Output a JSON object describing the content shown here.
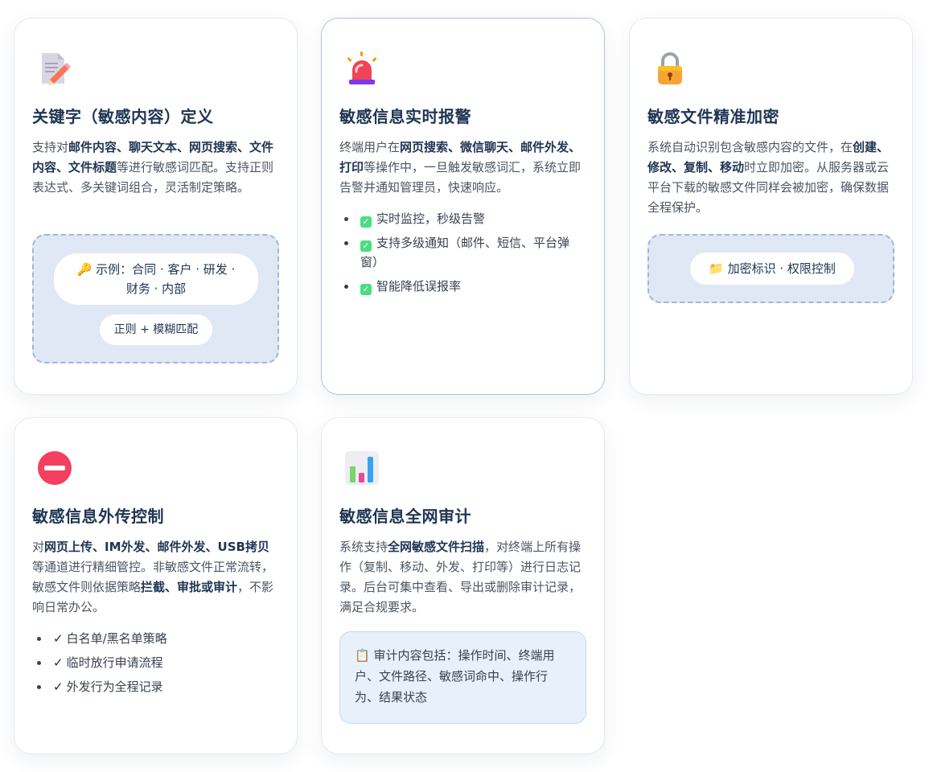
{
  "cards": [
    {
      "icon": "memo-pencil-icon",
      "title": "关键字（敏感内容）定义",
      "desc_parts": [
        "支持对",
        "邮件内容、聊天文本、网页搜索、文件内容、文件标题",
        "等进行敏感词匹配。支持正则表达式、多关键词组合，灵活制定策略。"
      ],
      "example_icon": "🔑",
      "example_text": "示例：合同 · 客户 · 研发 · 财务 · 内部",
      "match_label": "正则 + 模糊匹配"
    },
    {
      "icon": "siren-icon",
      "title": "敏感信息实时报警",
      "desc_parts": [
        "终端用户在",
        "网页搜索、微信聊天、邮件外发、打印",
        "等操作中，一旦触发敏感词汇，系统立即告警并通知管理员，快速响应。"
      ],
      "checks": [
        "实时监控，秒级告警",
        "支持多级通知（邮件、短信、平台弹窗）",
        "智能降低误报率"
      ]
    },
    {
      "icon": "lock-icon",
      "title": "敏感文件精准加密",
      "desc_parts": [
        "系统自动识别包含敏感内容的文件，在",
        "创建、修改、复制、移动",
        "时立即加密。从服务器或云平台下载的敏感文件同样会被加密，确保数据全程保护。"
      ],
      "folder_icon": "📁",
      "tag_text": "加密标识 · 权限控制"
    },
    {
      "icon": "no-entry-icon",
      "title": "敏感信息外传控制",
      "desc_parts": [
        "对",
        "网页上传、IM外发、邮件外发、USB拷贝",
        "等通道进行精细管控。非敏感文件正常流转，敏感文件则依据策略",
        "拦截、审批或审计",
        "，不影响日常办公。"
      ],
      "checks": [
        "白名单/黑名单策略",
        "临时放行申请流程",
        "外发行为全程记录"
      ]
    },
    {
      "icon": "bar-chart-icon",
      "title": "敏感信息全网审计",
      "desc_parts": [
        "系统支持",
        "全网敏感文件扫描",
        "，对终端上所有操作（复制、移动、外发、打印等）进行日志记录。后台可集中查看、导出或删除审计记录，满足合规要求。"
      ],
      "note_icon": "📋",
      "note_text": "审计内容包括：操作时间、终端用户、文件路径、敏感词命中、操作行为、结果状态"
    }
  ],
  "check_mark": "✓"
}
